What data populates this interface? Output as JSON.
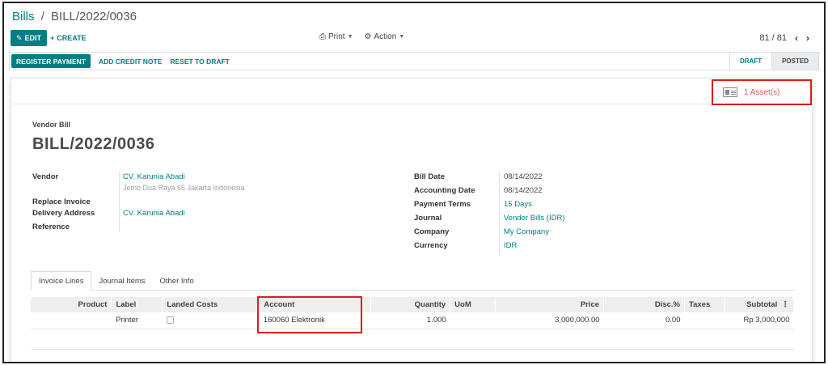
{
  "breadcrumb": {
    "parent": "Bills",
    "separator": "/",
    "current": "BILL/2022/0036"
  },
  "toolbar": {
    "edit_label": "EDIT",
    "create_label": "CREATE",
    "print_label": "Print",
    "action_label": "Action"
  },
  "pager": {
    "value": "81 / 81"
  },
  "statusbar": {
    "register_payment": "REGISTER PAYMENT",
    "add_credit_note": "ADD CREDIT NOTE",
    "reset_to_draft": "RESET TO DRAFT",
    "states": [
      "DRAFT",
      "POSTED"
    ],
    "active_state": "POSTED"
  },
  "smart_button": {
    "label": "1 Asset(s)",
    "icon": "asset-icon"
  },
  "document": {
    "type_label": "Vendor Bill",
    "name": "BILL/2022/0036"
  },
  "left_fields": {
    "vendor_label": "Vendor",
    "vendor_value": "CV. Karunia Abadi",
    "vendor_address": "Jemb Dua Raya 65 Jakarta Indonesia",
    "replace_invoice_label": "Replace Invoice",
    "delivery_address_label": "Delivery Address",
    "delivery_address_value": "CV. Karunia Abadi",
    "reference_label": "Reference"
  },
  "right_fields": {
    "bill_date_label": "Bill Date",
    "bill_date_value": "08/14/2022",
    "accounting_date_label": "Accounting Date",
    "accounting_date_value": "08/14/2022",
    "payment_terms_label": "Payment Terms",
    "payment_terms_value": "15 Days",
    "journal_label": "Journal",
    "journal_value": "Vendor Bills (IDR)",
    "company_label": "Company",
    "company_value": "My Company",
    "currency_label": "Currency",
    "currency_value": "IDR"
  },
  "tabs": [
    {
      "label": "Invoice Lines",
      "active": true
    },
    {
      "label": "Journal Items",
      "active": false
    },
    {
      "label": "Other Info",
      "active": false
    }
  ],
  "table": {
    "columns": [
      "Product",
      "Label",
      "Landed Costs",
      "Account",
      "Quantity",
      "UoM",
      "Price",
      "Disc.%",
      "Taxes",
      "Subtotal"
    ],
    "rows": [
      {
        "product": "",
        "label": "Printer",
        "landed_costs": false,
        "account": "160060 Elektronik",
        "quantity": "1.000",
        "uom": "",
        "price": "3,000,000.00",
        "discount": "0.00",
        "taxes": "",
        "subtotal": "Rp 3,000,000"
      }
    ]
  },
  "colors": {
    "primary": "#017e84",
    "highlight": "#e01b1b"
  }
}
